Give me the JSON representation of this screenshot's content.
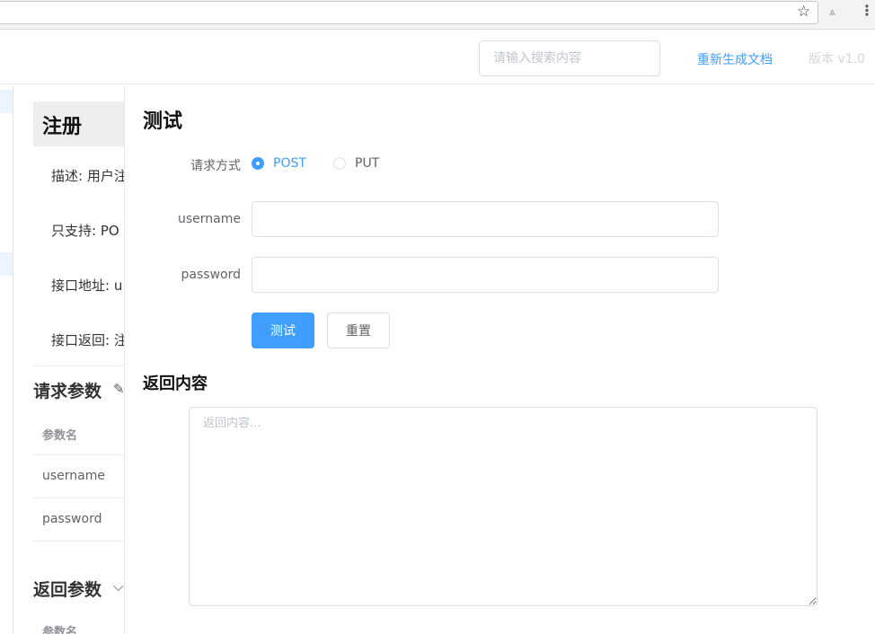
{
  "browser": {
    "star_icon": "☆",
    "ext_icon": "⩓",
    "menu_icon": "⋮"
  },
  "header": {
    "search_placeholder": "请输入搜索内容",
    "regenerate_label": "重新生成文档",
    "version_label": "版本 v1.0"
  },
  "doc": {
    "title": "注册",
    "description": "描述: 用户注",
    "supports": "只支持: PO",
    "address": "接口地址: u",
    "returns": "接口返回: 注",
    "request_params": {
      "heading": "请求参数",
      "icon": "edit-icon",
      "column_header": "参数名",
      "rows": [
        "username",
        "password"
      ]
    },
    "response_params": {
      "heading": "返回参数",
      "icon": "chevron-down-icon",
      "column_header": "参数名"
    }
  },
  "test_panel": {
    "title": "测试",
    "method_label": "请求方式",
    "methods": [
      {
        "label": "POST",
        "selected": true
      },
      {
        "label": "PUT",
        "selected": false
      }
    ],
    "fields": [
      {
        "label": "username",
        "value": ""
      },
      {
        "label": "password",
        "value": ""
      }
    ],
    "submit_label": "测试",
    "reset_label": "重置",
    "response_title": "返回内容",
    "response_placeholder": "返回内容..."
  },
  "colors": {
    "primary": "#409eff",
    "border": "#dcdfe6",
    "muted_text": "#c0c4cc"
  }
}
